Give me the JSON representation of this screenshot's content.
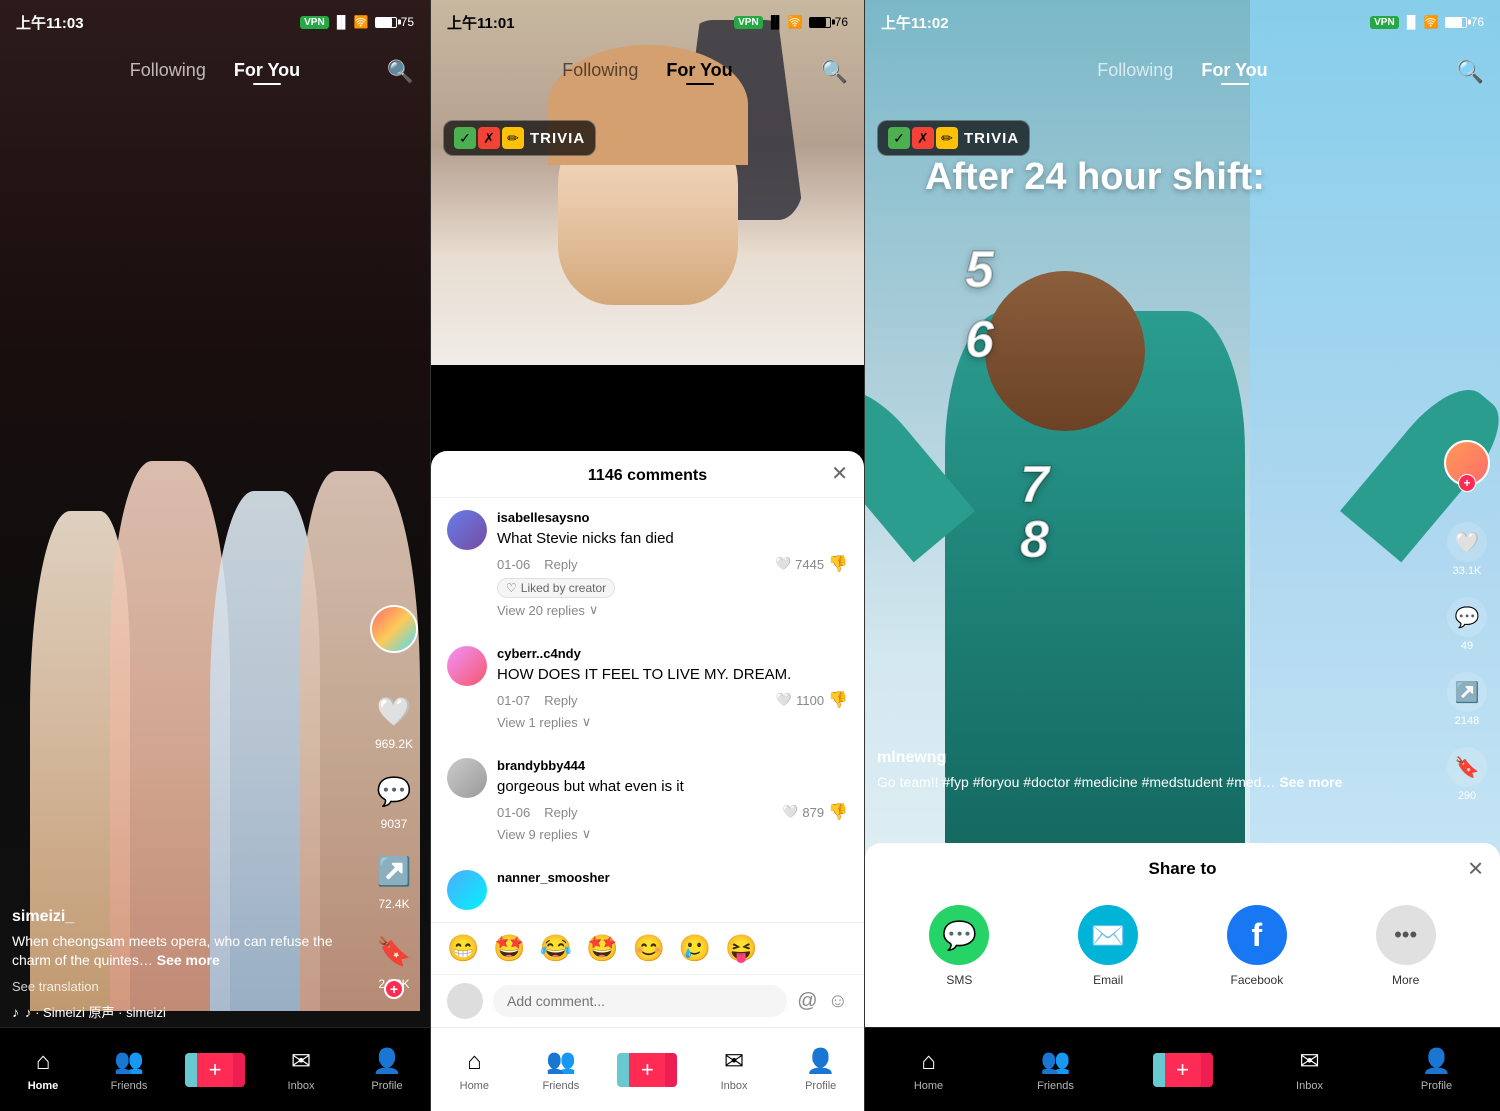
{
  "panels": {
    "left": {
      "status_time": "上午11:03",
      "nav": {
        "following": "Following",
        "for_you": "For You",
        "active": "For You"
      },
      "user_handle": "simeizi_",
      "video_desc": "When cheongsam meets opera, who can refuse the charm of the quintes…",
      "see_more": "See more",
      "translate": "See translation",
      "music": "♪ · Simeizi   原声 · simeizi",
      "likes": "969.2K",
      "comments": "9037",
      "shares": "72.4K",
      "saves": "24.3K",
      "bottom_nav": {
        "home": "Home",
        "friends": "Friends",
        "plus": "+",
        "inbox": "Inbox",
        "profile": "Profile"
      }
    },
    "middle": {
      "status_time": "上午11:01",
      "nav": {
        "following": "Following",
        "for_you": "For You"
      },
      "trivia": "TRIVIA",
      "comments_count": "1146 comments",
      "comments": [
        {
          "username": "isabellesaysno",
          "text": "What Stevie nicks fan died",
          "date": "01-06",
          "reply": "Reply",
          "likes": "7445",
          "liked_by_creator": "Liked by creator",
          "view_replies": "View 20 replies"
        },
        {
          "username": "cyberr..c4ndy",
          "text": "HOW DOES IT FEEL TO LIVE MY. DREAM.",
          "date": "01-07",
          "reply": "Reply",
          "likes": "1100",
          "view_replies": "View 1 replies"
        },
        {
          "username": "brandybby444",
          "text": "gorgeous but what even is it",
          "date": "01-06",
          "reply": "Reply",
          "likes": "879",
          "view_replies": "View 9 replies"
        },
        {
          "username": "nanner_smoosher",
          "text": "",
          "date": "",
          "reply": "",
          "likes": ""
        }
      ],
      "emojis": [
        "😁",
        "🤩",
        "😂",
        "🤩",
        "😊",
        "🥲",
        "😝"
      ],
      "comment_placeholder": "Add comment...",
      "bottom_nav": {
        "home": "Home",
        "friends": "Friends",
        "plus": "+",
        "inbox": "Inbox",
        "profile": "Profile"
      }
    },
    "right": {
      "status_time": "上午11:02",
      "nav": {
        "following": "Following",
        "for_you": "For You"
      },
      "trivia": "TRIVIA",
      "overlay_text": "After 24 hour shift:",
      "numbers": [
        "5",
        "6",
        "7",
        "8"
      ],
      "user_handle": "mlnewng",
      "video_desc": "Go team!! #fyp #foryou #doctor #medicine #medstudent #med…",
      "see_more": "See more",
      "likes": "33.1K",
      "comments": "49",
      "shares": "2148",
      "saves": "290",
      "share_title": "Share to",
      "share_options": [
        {
          "label": "SMS",
          "icon": "💬"
        },
        {
          "label": "Email",
          "icon": "✉️"
        },
        {
          "label": "Facebook",
          "icon": "f"
        },
        {
          "label": "More",
          "icon": "···"
        }
      ],
      "bottom_nav": {
        "home": "Home",
        "friends": "Friends",
        "plus": "+",
        "inbox": "Inbox",
        "profile": "Profile"
      }
    }
  }
}
